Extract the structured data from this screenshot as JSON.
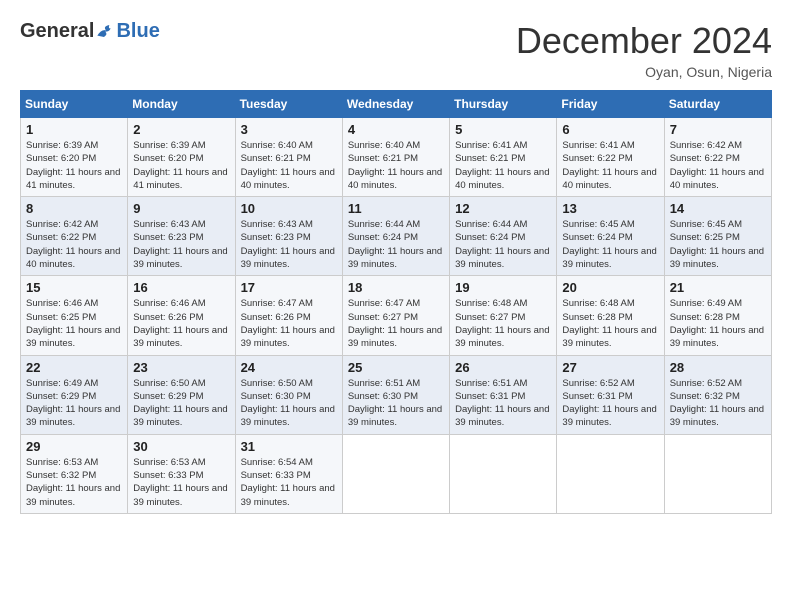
{
  "header": {
    "logo_general": "General",
    "logo_blue": "Blue",
    "month_title": "December 2024",
    "location": "Oyan, Osun, Nigeria"
  },
  "days_of_week": [
    "Sunday",
    "Monday",
    "Tuesday",
    "Wednesday",
    "Thursday",
    "Friday",
    "Saturday"
  ],
  "weeks": [
    [
      {
        "day": "1",
        "sunrise": "6:39 AM",
        "sunset": "6:20 PM",
        "daylight": "11 hours and 41 minutes."
      },
      {
        "day": "2",
        "sunrise": "6:39 AM",
        "sunset": "6:20 PM",
        "daylight": "11 hours and 41 minutes."
      },
      {
        "day": "3",
        "sunrise": "6:40 AM",
        "sunset": "6:21 PM",
        "daylight": "11 hours and 40 minutes."
      },
      {
        "day": "4",
        "sunrise": "6:40 AM",
        "sunset": "6:21 PM",
        "daylight": "11 hours and 40 minutes."
      },
      {
        "day": "5",
        "sunrise": "6:41 AM",
        "sunset": "6:21 PM",
        "daylight": "11 hours and 40 minutes."
      },
      {
        "day": "6",
        "sunrise": "6:41 AM",
        "sunset": "6:22 PM",
        "daylight": "11 hours and 40 minutes."
      },
      {
        "day": "7",
        "sunrise": "6:42 AM",
        "sunset": "6:22 PM",
        "daylight": "11 hours and 40 minutes."
      }
    ],
    [
      {
        "day": "8",
        "sunrise": "6:42 AM",
        "sunset": "6:22 PM",
        "daylight": "11 hours and 40 minutes."
      },
      {
        "day": "9",
        "sunrise": "6:43 AM",
        "sunset": "6:23 PM",
        "daylight": "11 hours and 39 minutes."
      },
      {
        "day": "10",
        "sunrise": "6:43 AM",
        "sunset": "6:23 PM",
        "daylight": "11 hours and 39 minutes."
      },
      {
        "day": "11",
        "sunrise": "6:44 AM",
        "sunset": "6:24 PM",
        "daylight": "11 hours and 39 minutes."
      },
      {
        "day": "12",
        "sunrise": "6:44 AM",
        "sunset": "6:24 PM",
        "daylight": "11 hours and 39 minutes."
      },
      {
        "day": "13",
        "sunrise": "6:45 AM",
        "sunset": "6:24 PM",
        "daylight": "11 hours and 39 minutes."
      },
      {
        "day": "14",
        "sunrise": "6:45 AM",
        "sunset": "6:25 PM",
        "daylight": "11 hours and 39 minutes."
      }
    ],
    [
      {
        "day": "15",
        "sunrise": "6:46 AM",
        "sunset": "6:25 PM",
        "daylight": "11 hours and 39 minutes."
      },
      {
        "day": "16",
        "sunrise": "6:46 AM",
        "sunset": "6:26 PM",
        "daylight": "11 hours and 39 minutes."
      },
      {
        "day": "17",
        "sunrise": "6:47 AM",
        "sunset": "6:26 PM",
        "daylight": "11 hours and 39 minutes."
      },
      {
        "day": "18",
        "sunrise": "6:47 AM",
        "sunset": "6:27 PM",
        "daylight": "11 hours and 39 minutes."
      },
      {
        "day": "19",
        "sunrise": "6:48 AM",
        "sunset": "6:27 PM",
        "daylight": "11 hours and 39 minutes."
      },
      {
        "day": "20",
        "sunrise": "6:48 AM",
        "sunset": "6:28 PM",
        "daylight": "11 hours and 39 minutes."
      },
      {
        "day": "21",
        "sunrise": "6:49 AM",
        "sunset": "6:28 PM",
        "daylight": "11 hours and 39 minutes."
      }
    ],
    [
      {
        "day": "22",
        "sunrise": "6:49 AM",
        "sunset": "6:29 PM",
        "daylight": "11 hours and 39 minutes."
      },
      {
        "day": "23",
        "sunrise": "6:50 AM",
        "sunset": "6:29 PM",
        "daylight": "11 hours and 39 minutes."
      },
      {
        "day": "24",
        "sunrise": "6:50 AM",
        "sunset": "6:30 PM",
        "daylight": "11 hours and 39 minutes."
      },
      {
        "day": "25",
        "sunrise": "6:51 AM",
        "sunset": "6:30 PM",
        "daylight": "11 hours and 39 minutes."
      },
      {
        "day": "26",
        "sunrise": "6:51 AM",
        "sunset": "6:31 PM",
        "daylight": "11 hours and 39 minutes."
      },
      {
        "day": "27",
        "sunrise": "6:52 AM",
        "sunset": "6:31 PM",
        "daylight": "11 hours and 39 minutes."
      },
      {
        "day": "28",
        "sunrise": "6:52 AM",
        "sunset": "6:32 PM",
        "daylight": "11 hours and 39 minutes."
      }
    ],
    [
      {
        "day": "29",
        "sunrise": "6:53 AM",
        "sunset": "6:32 PM",
        "daylight": "11 hours and 39 minutes."
      },
      {
        "day": "30",
        "sunrise": "6:53 AM",
        "sunset": "6:33 PM",
        "daylight": "11 hours and 39 minutes."
      },
      {
        "day": "31",
        "sunrise": "6:54 AM",
        "sunset": "6:33 PM",
        "daylight": "11 hours and 39 minutes."
      },
      null,
      null,
      null,
      null
    ]
  ],
  "labels": {
    "sunrise": "Sunrise:",
    "sunset": "Sunset:",
    "daylight": "Daylight:"
  }
}
